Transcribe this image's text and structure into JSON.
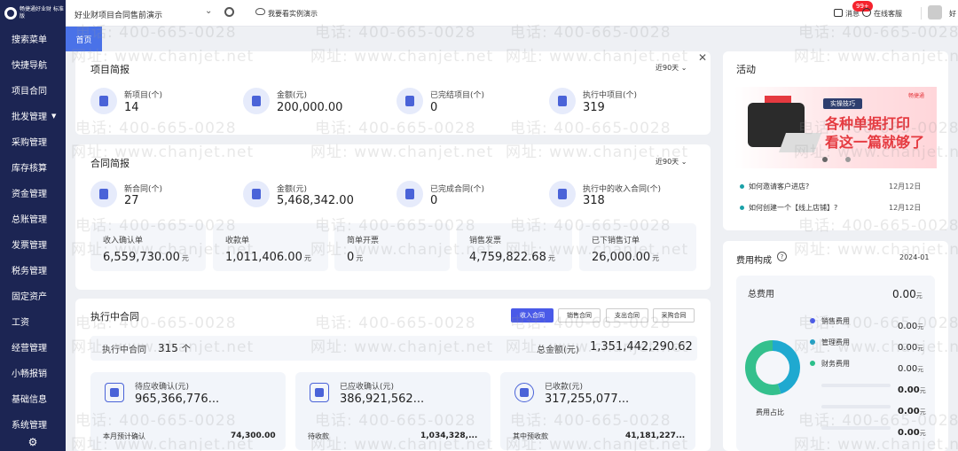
{
  "app": {
    "logo_text": "畅捷通好业财 标准版"
  },
  "sidebar": {
    "items": [
      "搜索菜单",
      "快捷导航",
      "项目合同",
      "批发管理",
      "采购管理",
      "库存核算",
      "资金管理",
      "总账管理",
      "发票管理",
      "税务管理",
      "固定资产",
      "工资",
      "经营管理",
      "小畅报销",
      "基础信息",
      "系统管理"
    ]
  },
  "topbar": {
    "company": "好业财项目合同售前演示",
    "demo": "我要看实例演示",
    "messages": "消息",
    "messages_badge": "99+",
    "service": "在线客服",
    "user": "好"
  },
  "tabs": {
    "home": "首页"
  },
  "project_brief": {
    "title": "项目简报",
    "range": "近90天",
    "stats": [
      {
        "label": "新项目(个)",
        "value": "14"
      },
      {
        "label": "金额(元)",
        "value": "200,000.00"
      },
      {
        "label": "已完结项目(个)",
        "value": "0"
      },
      {
        "label": "执行中项目(个)",
        "value": "319"
      }
    ]
  },
  "contract_brief": {
    "title": "合同简报",
    "range": "近90天",
    "stats": [
      {
        "label": "新合同(个)",
        "value": "27"
      },
      {
        "label": "金额(元)",
        "value": "5,468,342.00"
      },
      {
        "label": "已完成合同(个)",
        "value": "0"
      },
      {
        "label": "执行中的收入合同(个)",
        "value": "318"
      }
    ],
    "chips": [
      {
        "label": "收入确认单",
        "value": "6,559,730.00",
        "unit": "元"
      },
      {
        "label": "收款单",
        "value": "1,011,406.00",
        "unit": "元"
      },
      {
        "label": "简单开票",
        "value": "0",
        "unit": "元"
      },
      {
        "label": "销售发票",
        "value": "4,759,822.68",
        "unit": "元"
      },
      {
        "label": "已下销售订单",
        "value": "26,000.00",
        "unit": "元"
      }
    ]
  },
  "executing": {
    "title": "执行中合同",
    "tabs": [
      "收入合同",
      "销售合同",
      "支出合同",
      "采购合同"
    ],
    "count_label": "执行中合同",
    "count_value": "315",
    "count_unit": "个",
    "total_label": "总金额(元)",
    "total_value": "1,351,442,290.62",
    "cards": [
      {
        "label": "待应收确认(元)",
        "value": "965,366,776...",
        "sub_label": "本月预计确认",
        "sub_value": "74,300.00"
      },
      {
        "label": "已应收确认(元)",
        "value": "386,921,562...",
        "sub_label": "待收款",
        "sub_value": "1,034,328,..."
      },
      {
        "label": "已收款(元)",
        "value": "317,255,077...",
        "sub_label": "其中预收款",
        "sub_value": "41,181,227..."
      }
    ]
  },
  "activity": {
    "title": "活动",
    "banner_tag": "实操技巧",
    "banner_logo": "畅捷通",
    "banner_line1": "各种单据打印",
    "banner_line2": "看这一篇就够了",
    "news": [
      {
        "text": "如何邀请客户进店?",
        "date": "12月12日"
      },
      {
        "text": "如何创建一个【线上店铺】?",
        "date": "12月12日"
      }
    ]
  },
  "fee": {
    "title": "费用构成",
    "period": "2024-01",
    "total_label": "总费用",
    "total_value": "0.00",
    "unit": "元",
    "center_label": "费用占比",
    "legend": [
      {
        "label": "销售费用",
        "value": "0.00",
        "color": "#4a5ae8"
      },
      {
        "label": "管理费用",
        "value": "0.00",
        "color": "#1aa1c8"
      },
      {
        "label": "财务费用",
        "value": "0.00",
        "color": "#2bbf8a"
      }
    ],
    "extra_values": [
      "0.00",
      "0.00",
      "0.00"
    ],
    "donut": [
      {
        "share": 0.45,
        "color": "#1fa9d0"
      },
      {
        "share": 0.55,
        "color": "#34c08d"
      }
    ]
  },
  "watermark": {
    "phone": "电话: 400-665-0028",
    "site": "网址: www.chanjet.net"
  }
}
